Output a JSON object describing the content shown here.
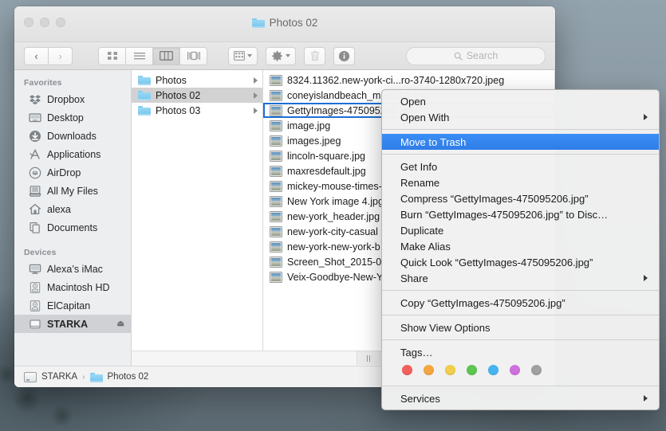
{
  "window": {
    "title": "Photos 02",
    "title_icon": "folder-icon",
    "traffic_lights": [
      "close",
      "minimize",
      "zoom"
    ]
  },
  "toolbar": {
    "back_label": "‹",
    "forward_label": "›",
    "view_modes": [
      {
        "name": "icon-view",
        "active": false
      },
      {
        "name": "list-view",
        "active": false
      },
      {
        "name": "column-view",
        "active": true
      },
      {
        "name": "coverflow-view",
        "active": false
      }
    ],
    "arrange_label": "arrange-icon",
    "action_label": "gear-icon",
    "trash_label": "trash-icon",
    "info_label": "info-icon",
    "search_placeholder": "Search",
    "search_value": ""
  },
  "sidebar": {
    "sections": [
      {
        "heading": "Favorites",
        "items": [
          {
            "label": "Dropbox",
            "icon": "dropbox-icon",
            "selected": false
          },
          {
            "label": "Desktop",
            "icon": "desktop-icon",
            "selected": false
          },
          {
            "label": "Downloads",
            "icon": "downloads-icon",
            "selected": false
          },
          {
            "label": "Applications",
            "icon": "applications-icon",
            "selected": false
          },
          {
            "label": "AirDrop",
            "icon": "airdrop-icon",
            "selected": false
          },
          {
            "label": "All My Files",
            "icon": "all-my-files-icon",
            "selected": false
          },
          {
            "label": "alexa",
            "icon": "home-icon",
            "selected": false
          },
          {
            "label": "Documents",
            "icon": "documents-icon",
            "selected": false
          }
        ]
      },
      {
        "heading": "Devices",
        "items": [
          {
            "label": "Alexa’s iMac",
            "icon": "imac-icon",
            "selected": false
          },
          {
            "label": "Macintosh HD",
            "icon": "harddisk-icon",
            "selected": false
          },
          {
            "label": "ElCapitan",
            "icon": "harddisk-icon",
            "selected": false
          },
          {
            "label": "STARKA",
            "icon": "external-drive-icon",
            "selected": true,
            "eject": "⏏"
          }
        ]
      }
    ]
  },
  "columns": {
    "folders": [
      {
        "label": "Photos",
        "selected": false
      },
      {
        "label": "Photos 02",
        "selected": true
      },
      {
        "label": "Photos 03",
        "selected": false
      }
    ],
    "files": [
      {
        "label": "8324.11362.new-york-ci...ro-3740-1280x720.jpeg",
        "selected": false
      },
      {
        "label": "coneyislandbeach_main.0.0.jpg",
        "selected": false
      },
      {
        "label": "GettyImages-475095206.jpg",
        "selected": true
      },
      {
        "label": "image.jpg",
        "selected": false
      },
      {
        "label": "images.jpeg",
        "selected": false
      },
      {
        "label": "lincoln-square.jpg",
        "selected": false
      },
      {
        "label": "maxresdefault.jpg",
        "selected": false
      },
      {
        "label": "mickey-mouse-times-",
        "selected": false
      },
      {
        "label": "New York image 4.jpg",
        "selected": false
      },
      {
        "label": "new-york_header.jpg",
        "selected": false
      },
      {
        "label": "new-york-city-casual",
        "selected": false
      },
      {
        "label": "new-york-new-york-b",
        "selected": false
      },
      {
        "label": "Screen_Shot_2015-0",
        "selected": false
      },
      {
        "label": "Veix-Goodbye-New-Y",
        "selected": false
      }
    ]
  },
  "pathbar": {
    "items": [
      {
        "label": "STARKA",
        "icon": "drive-icon"
      },
      {
        "label": "Photos 02",
        "icon": "folder-icon"
      }
    ],
    "separator": "›"
  },
  "context_menu": {
    "groups": [
      {
        "items": [
          {
            "label": "Open",
            "submenu": false,
            "highlighted": false
          },
          {
            "label": "Open With",
            "submenu": true,
            "highlighted": false
          }
        ]
      },
      {
        "items": [
          {
            "label": "Move to Trash",
            "submenu": false,
            "highlighted": true
          }
        ]
      },
      {
        "items": [
          {
            "label": "Get Info",
            "submenu": false,
            "highlighted": false
          },
          {
            "label": "Rename",
            "submenu": false,
            "highlighted": false
          },
          {
            "label": "Compress “GettyImages-475095206.jpg”",
            "submenu": false,
            "highlighted": false
          },
          {
            "label": "Burn “GettyImages-475095206.jpg” to Disc…",
            "submenu": false,
            "highlighted": false
          },
          {
            "label": "Duplicate",
            "submenu": false,
            "highlighted": false
          },
          {
            "label": "Make Alias",
            "submenu": false,
            "highlighted": false
          },
          {
            "label": "Quick Look “GettyImages-475095206.jpg”",
            "submenu": false,
            "highlighted": false
          },
          {
            "label": "Share",
            "submenu": true,
            "highlighted": false
          }
        ]
      },
      {
        "items": [
          {
            "label": "Copy “GettyImages-475095206.jpg”",
            "submenu": false,
            "highlighted": false
          }
        ]
      },
      {
        "items": [
          {
            "label": "Show View Options",
            "submenu": false,
            "highlighted": false
          }
        ]
      },
      {
        "items": [
          {
            "label": "Tags…",
            "submenu": false,
            "highlighted": false
          }
        ],
        "tags": [
          "#f4615c",
          "#f5a640",
          "#f2ce4b",
          "#5ec650",
          "#47b3f0",
          "#d070e0",
          "#a0a0a0"
        ]
      },
      {
        "items": [
          {
            "label": "Services",
            "submenu": true,
            "highlighted": false
          }
        ]
      }
    ]
  },
  "colors": {
    "accent": "#2f7de8",
    "selection_outline": "#1d6fd6",
    "sidebar_bg": "#eceef0"
  }
}
